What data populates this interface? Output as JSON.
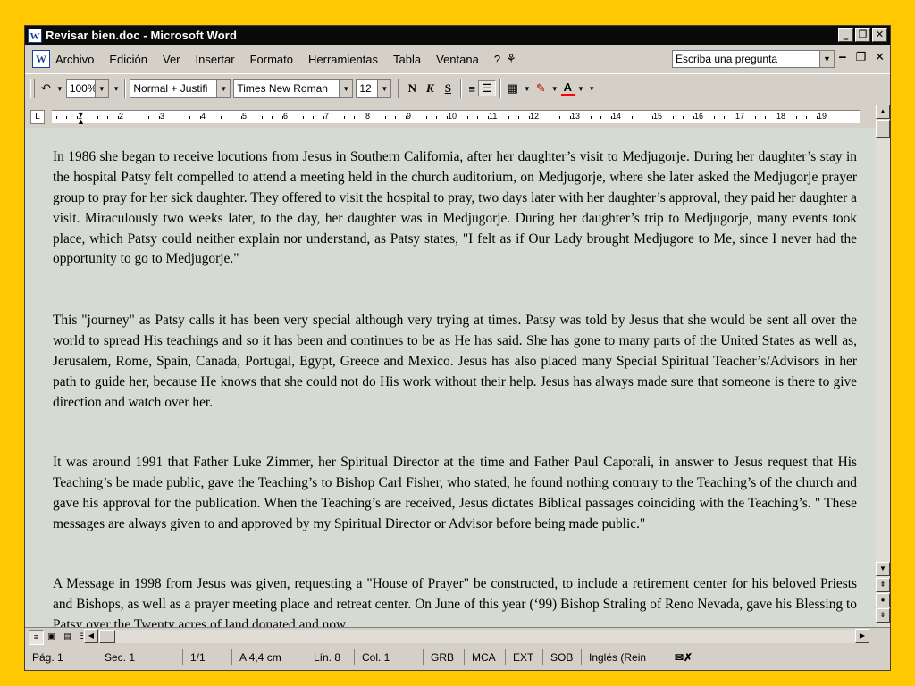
{
  "window": {
    "title": "Revisar bien.doc - Microsoft Word"
  },
  "menu": {
    "items": [
      "Archivo",
      "Edición",
      "Ver",
      "Insertar",
      "Formato",
      "Herramientas",
      "Tabla",
      "Ventana",
      "?"
    ],
    "ask_placeholder": "Escriba una pregunta"
  },
  "toolbar": {
    "zoom": "100%",
    "style": "Normal + Justifi",
    "font": "Times New Roman",
    "size": "12",
    "bold": "N",
    "italic": "K",
    "underline": "S"
  },
  "ruler": {
    "marks": [
      "1",
      "2",
      "3",
      "4",
      "5",
      "6",
      "7",
      "8",
      "9",
      "10",
      "11",
      "12",
      "13",
      "14",
      "15",
      "16",
      "17",
      "18",
      "19"
    ]
  },
  "document": {
    "paragraphs": [
      " In 1986 she began to receive locutions from Jesus in Southern California, after her daughter’s visit to Medjugorje. During her daughter’s stay in the hospital Patsy felt compelled to attend a meeting held in the church auditorium, on Medjugorje, where she later asked the Medjugorje prayer group to pray for her sick daughter. They offered to visit the hospital to pray, two days later with her daughter’s approval, they paid her daughter a visit. Miraculously two weeks later, to the day, her daughter was in Medjugorje. During her daughter’s trip to Medjugorje, many events took place, which Patsy could neither explain nor understand, as Patsy states, \"I felt as if Our Lady brought Medjugore to Me, since I never had the opportunity to go to Medjugorje.\"",
      " This \"journey\" as Patsy calls it has been very special although very trying at times. Patsy was told by Jesus that she would be sent all over the world to spread His teachings and so it has been and continues to be as He has said. She has gone to many parts of the United States as well as, Jerusalem, Rome, Spain, Canada, Portugal, Egypt, Greece and Mexico. Jesus has also placed many Special Spiritual Teacher’s/Advisors in her path to guide her, because He knows that she could not do His work without their help. Jesus has always made sure that someone is there to give direction and watch over her.",
      " It was around 1991 that Father Luke Zimmer, her Spiritual Director at the time and Father Paul Caporali, in answer to Jesus request that His Teaching’s be made public, gave the Teaching’s to Bishop Carl Fisher, who stated, he found nothing contrary to the Teaching’s of the church and gave his approval for the publication. When the Teaching’s are received, Jesus dictates Biblical passages coinciding with the Teaching’s. \" These messages are always given to and approved by my Spiritual Director or Advisor before being made public.\"",
      "  A Message in 1998 from Jesus was given, requesting a \"House of Prayer\" be constructed, to include a retirement center for his beloved Priests and Bishops, as well as a prayer meeting place and retreat center. On June of this year (‘99) Bishop Straling of Reno Nevada, gave his Blessing to Patsy over the Twenty acres of land donated and now"
    ]
  },
  "status": {
    "page": "Pág. 1",
    "section": "Sec. 1",
    "pages": "1/1",
    "at": "A 4,4 cm",
    "line": "Lín. 8",
    "col": "Col. 1",
    "grb": "GRB",
    "mca": "MCA",
    "ext": "EXT",
    "sob": "SOB",
    "language": "Inglés (Rein"
  }
}
